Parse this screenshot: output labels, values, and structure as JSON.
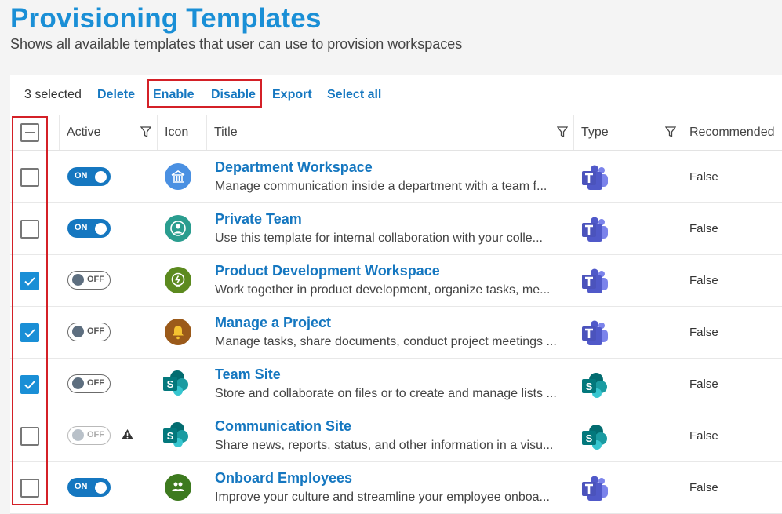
{
  "header": {
    "title": "Provisioning Templates",
    "subtitle": "Shows all available templates that user can use to provision workspaces"
  },
  "toolbar": {
    "selected_text": "3 selected",
    "delete_label": "Delete",
    "enable_label": "Enable",
    "disable_label": "Disable",
    "export_label": "Export",
    "select_all_label": "Select all"
  },
  "columns": {
    "active": "Active",
    "icon": "Icon",
    "title": "Title",
    "type": "Type",
    "recommended": "Recommended"
  },
  "rows": [
    {
      "checked": false,
      "active": true,
      "toggle_label": "ON",
      "icon": "bank-icon",
      "icon_color": "#4a90e2",
      "title": "Department Workspace",
      "description": "Manage communication inside a department with a team f...",
      "type_icon": "teams-icon",
      "recommended": "False"
    },
    {
      "checked": false,
      "active": true,
      "toggle_label": "ON",
      "icon": "person-icon",
      "icon_color": "#2a9d8f",
      "title": "Private Team",
      "description": "Use this template for internal collaboration with your colle...",
      "type_icon": "teams-icon",
      "recommended": "False"
    },
    {
      "checked": true,
      "active": false,
      "toggle_label": "OFF",
      "icon": "lightbulb-icon",
      "icon_color": "#5c8a1f",
      "title": "Product Development Workspace",
      "description": "Work together in product development, organize tasks, me...",
      "type_icon": "teams-icon",
      "recommended": "False"
    },
    {
      "checked": true,
      "active": false,
      "toggle_label": "OFF",
      "icon": "bell-icon",
      "icon_color": "#9b5a1a",
      "title": "Manage a Project",
      "description": "Manage tasks, share documents, conduct project meetings ...",
      "type_icon": "teams-icon",
      "recommended": "False"
    },
    {
      "checked": true,
      "active": false,
      "toggle_label": "OFF",
      "icon": "sharepoint-icon",
      "icon_color": "#038387",
      "title": "Team Site",
      "description": "Store and collaborate on files or to create and manage lists ...",
      "type_icon": "sharepoint-icon",
      "recommended": "False"
    },
    {
      "checked": false,
      "active": false,
      "disabled": true,
      "toggle_label": "OFF",
      "icon": "sharepoint-icon",
      "icon_color": "#038387",
      "title": "Communication Site",
      "description": "Share news, reports, status, and other information in a visu...",
      "type_icon": "sharepoint-icon",
      "recommended": "False",
      "warning": true
    },
    {
      "checked": false,
      "active": true,
      "toggle_label": "ON",
      "icon": "people-icon",
      "icon_color": "#3d7a1f",
      "title": "Onboard Employees",
      "description": "Improve your culture and streamline your employee onboa...",
      "type_icon": "teams-icon",
      "recommended": "False"
    }
  ],
  "colors": {
    "accent": "#1a8fd6",
    "link": "#1577c0",
    "highlight": "#d42027"
  }
}
